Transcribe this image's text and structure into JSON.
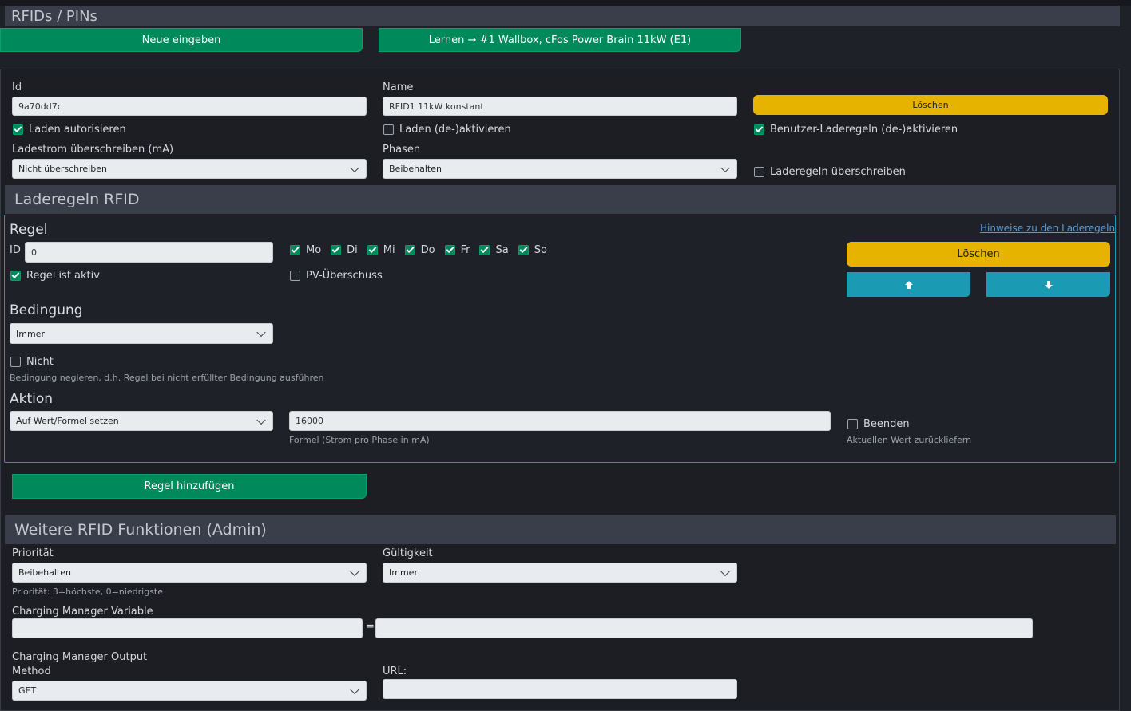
{
  "page_title": "RFIDs / PINs",
  "top_buttons": {
    "new": "Neue eingeben",
    "learn": "Lernen → #1 Wallbox, cFos Power Brain 11kW (E1)"
  },
  "rfid": {
    "id_label": "Id",
    "id_value": "9a70dd7c",
    "name_label": "Name",
    "name_value": "RFID1 11kW konstant",
    "delete": "Löschen",
    "authorize": "Laden autorisieren",
    "toggle_charging": "Laden (de-)aktivieren",
    "toggle_user_rules": "Benutzer-Laderegeln (de-)aktivieren",
    "override_current_label": "Ladestrom überschreiben (mA)",
    "override_current_value": "Nicht überschreiben",
    "phases_label": "Phasen",
    "phases_value": "Beibehalten",
    "override_rules": "Laderegeln überschreiben"
  },
  "rules_section": {
    "title": "Laderegeln RFID",
    "rule_title": "Regel",
    "hints_link": "Hinweise zu den Laderegeln",
    "id_label": "ID",
    "id_value": "0",
    "days": [
      "Mo",
      "Di",
      "Mi",
      "Do",
      "Fr",
      "Sa",
      "So"
    ],
    "delete": "Löschen",
    "active": "Regel ist aktiv",
    "pv_surplus": "PV-Überschuss",
    "condition_title": "Bedingung",
    "condition_value": "Immer",
    "not_label": "Nicht",
    "not_hint": "Bedingung negieren, d.h. Regel bei nicht erfüllter Bedingung ausführen",
    "action_title": "Aktion",
    "action_value": "Auf Wert/Formel setzen",
    "formula_value": "16000",
    "formula_hint": "Formel (Strom pro Phase in mA)",
    "finish": "Beenden",
    "finish_hint": "Aktuellen Wert zurückliefern",
    "add_rule": "Regel hinzufügen"
  },
  "admin": {
    "title": "Weitere RFID Funktionen (Admin)",
    "priority_label": "Priorität",
    "priority_value": "Beibehalten",
    "priority_hint": "Priorität: 3=höchste, 0=niedrigste",
    "validity_label": "Gültigkeit",
    "validity_value": "Immer",
    "variable_label": "Charging Manager Variable",
    "equals": "=",
    "output_label": "Charging Manager Output",
    "method_label": "Method",
    "method_value": "GET",
    "url_label": "URL:"
  },
  "colors": {
    "accent_green": "#00895a",
    "accent_yellow": "#e6b400",
    "accent_teal": "#1a9bb3",
    "background": "#1f2128"
  }
}
